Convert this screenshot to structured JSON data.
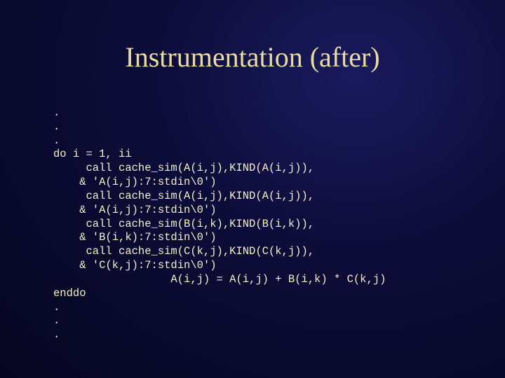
{
  "title": "Instrumentation (after)",
  "code_lines": [
    ".",
    ".",
    ".",
    "do i = 1, ii",
    "     call cache_sim(A(i,j),KIND(A(i,j)),",
    "    & 'A(i,j):7:stdin\\0')",
    "     call cache_sim(A(i,j),KIND(A(i,j)),",
    "    & 'A(i,j):7:stdin\\0')",
    "     call cache_sim(B(i,k),KIND(B(i,k)),",
    "    & 'B(i,k):7:stdin\\0')",
    "     call cache_sim(C(k,j),KIND(C(k,j)),",
    "    & 'C(k,j):7:stdin\\0')",
    "                  A(i,j) = A(i,j) + B(i,k) * C(k,j)",
    "enddo",
    ".",
    ".",
    "."
  ]
}
